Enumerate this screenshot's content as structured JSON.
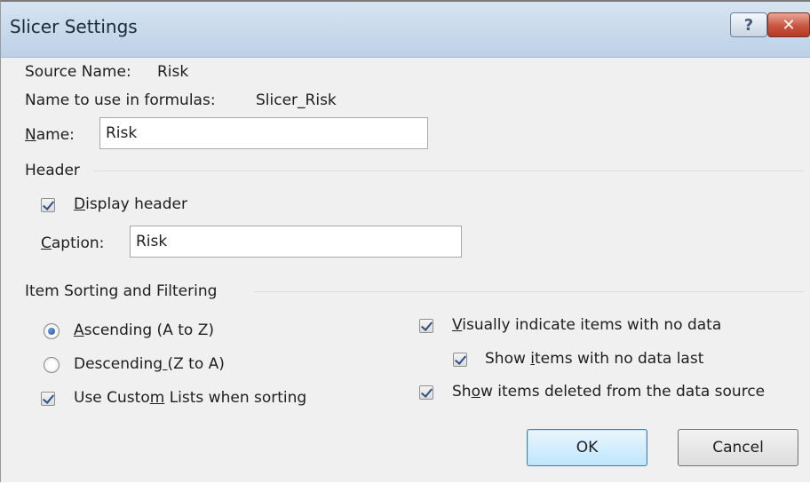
{
  "window": {
    "title": "Slicer Settings",
    "help_glyph": "?",
    "close_glyph": "✕"
  },
  "source": {
    "label": "Source Name:",
    "value": "Risk"
  },
  "formula": {
    "label": "Name to use in formulas:",
    "value": "Slicer_Risk"
  },
  "name_field": {
    "label_access": "N",
    "label_rest": "ame:",
    "value": "Risk"
  },
  "header_group": {
    "title": "Header",
    "display_header": {
      "label_access": "D",
      "label_rest": "isplay header",
      "checked": true
    },
    "caption": {
      "label_access": "C",
      "label_rest": "aption:",
      "value": "Risk"
    }
  },
  "sorting_group": {
    "title": "Item Sorting and Filtering",
    "ascending": {
      "label_access": "A",
      "label_rest": "scending (A to Z)",
      "selected": true
    },
    "descending": {
      "label_start": "Descending",
      "label_access": " ",
      "label_rest": "(Z to A)",
      "selected": false
    },
    "custom_lists": {
      "label_start": "Use Custo",
      "label_access": "m",
      "label_rest": " Lists when sorting",
      "checked": true
    },
    "visually_indicate": {
      "label_access": "V",
      "label_rest": "isually indicate items with no data",
      "checked": true
    },
    "show_last": {
      "label_start": "Show ",
      "label_access": "i",
      "label_rest": "tems with no data last",
      "checked": true
    },
    "show_deleted": {
      "label_start": "Sh",
      "label_access": "o",
      "label_rest": "w items deleted from the data source",
      "checked": true
    }
  },
  "buttons": {
    "ok": "OK",
    "cancel": "Cancel"
  },
  "colors": {
    "title_bar": "#c9daec",
    "dialog_bg": "#f0f0f0",
    "close_red": "#c9553f",
    "ok_border": "#3c7fb1"
  }
}
